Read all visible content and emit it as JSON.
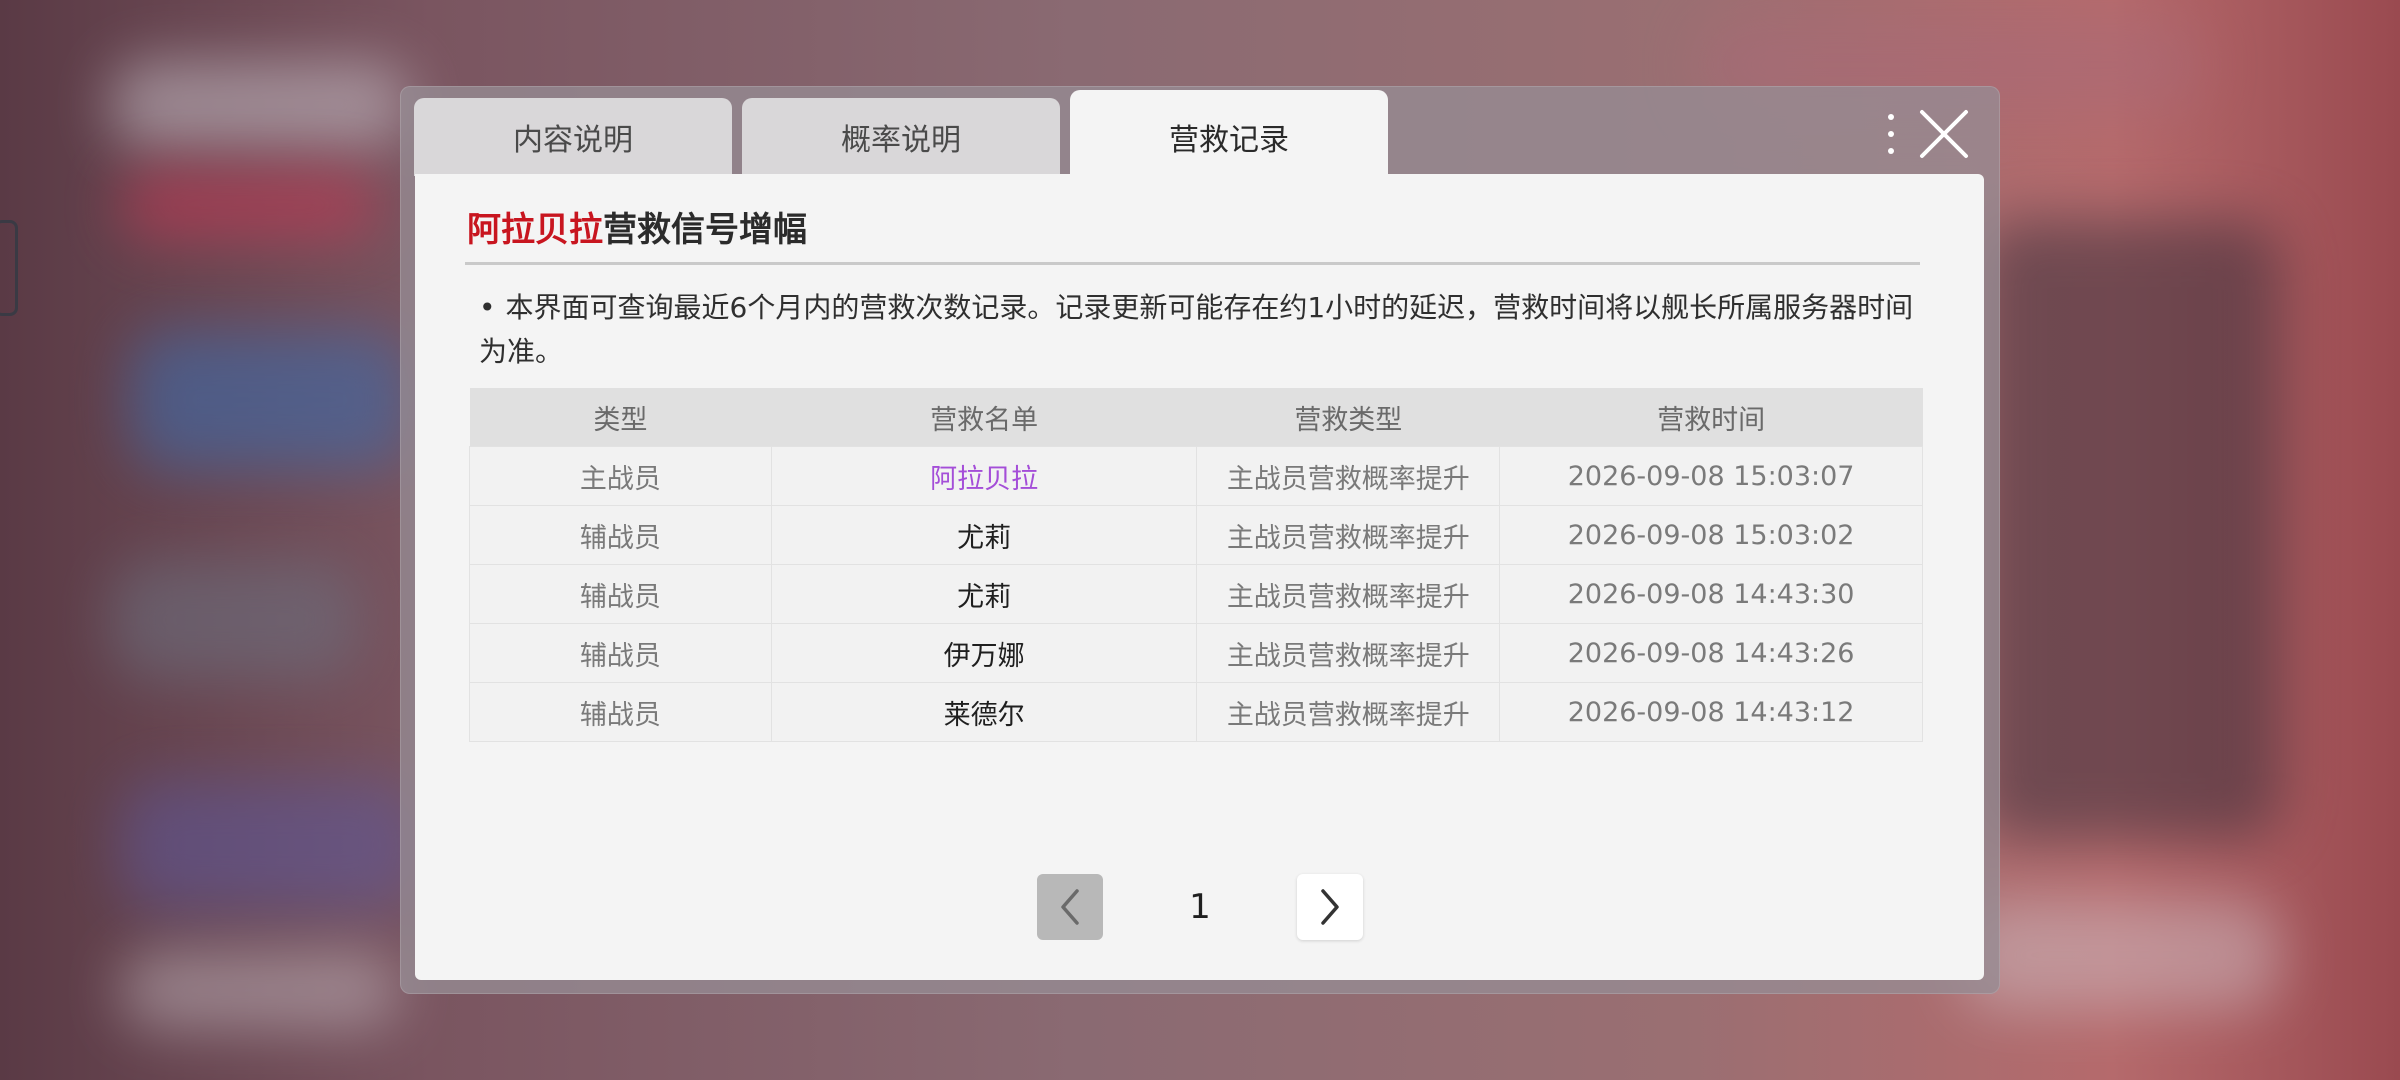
{
  "tabs": [
    {
      "label": "内容说明",
      "active": false
    },
    {
      "label": "概率说明",
      "active": false
    },
    {
      "label": "营救记录",
      "active": true
    }
  ],
  "panel": {
    "title_highlight": "阿拉贝拉",
    "title_rest": "营救信号增幅",
    "notice_bullet": "•",
    "notice": "本界面可查询最近6个月内的营救次数记录。记录更新可能存在约1小时的延迟，营救时间将以舰长所属服务器时间为准。"
  },
  "table": {
    "headers": [
      "类型",
      "营救名单",
      "营救类型",
      "营救时间"
    ],
    "rows": [
      {
        "type": "主战员",
        "name": "阿拉贝拉",
        "kind": "主战员营救概率提升",
        "time": "2026-09-08 15:03:07"
      },
      {
        "type": "辅战员",
        "name": "尤莉",
        "kind": "主战员营救概率提升",
        "time": "2026-09-08 15:03:02"
      },
      {
        "type": "辅战员",
        "name": "尤莉",
        "kind": "主战员营救概率提升",
        "time": "2026-09-08 14:43:30"
      },
      {
        "type": "辅战员",
        "name": "伊万娜",
        "kind": "主战员营救概率提升",
        "time": "2026-09-08 14:43:26"
      },
      {
        "type": "辅战员",
        "name": "莱德尔",
        "kind": "主战员营救概率提升",
        "time": "2026-09-08 14:43:12"
      }
    ]
  },
  "pagination": {
    "current_page": "1"
  },
  "colors": {
    "title_highlight": "#c8151f",
    "main_member_name": "#a44ed8"
  },
  "icons": {
    "close": "close-x-icon",
    "prev": "chevron-left-icon",
    "next": "chevron-right-icon"
  }
}
